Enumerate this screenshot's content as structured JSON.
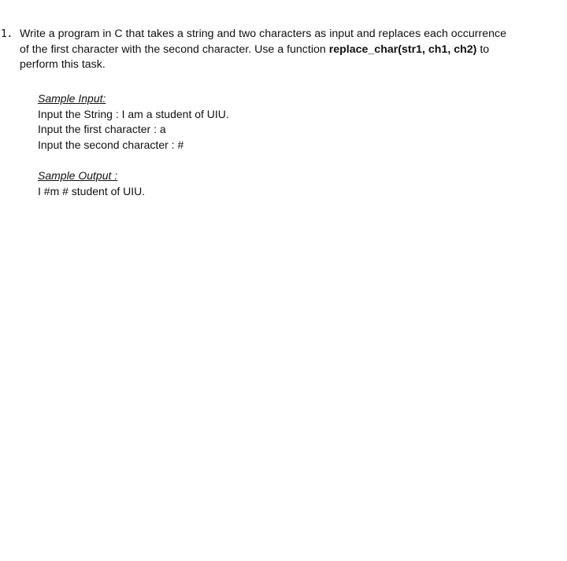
{
  "question": {
    "number": "1.",
    "line1": "Write a program in C that takes a string and two characters as input and replaces each occurrence",
    "line2": "of the first character with the second character. Use a function ",
    "function_signature": "replace_char(str1, ch1, ch2)",
    "line2_end": " to",
    "line3": "perform this task."
  },
  "sample_input": {
    "heading": "Sample Input:",
    "lines": [
      "Input the String : I am a student of UIU.",
      "Input the first character : a",
      "Input the second character : #"
    ]
  },
  "sample_output": {
    "heading": "Sample Output :",
    "lines": [
      "I #m # student of UIU."
    ]
  }
}
